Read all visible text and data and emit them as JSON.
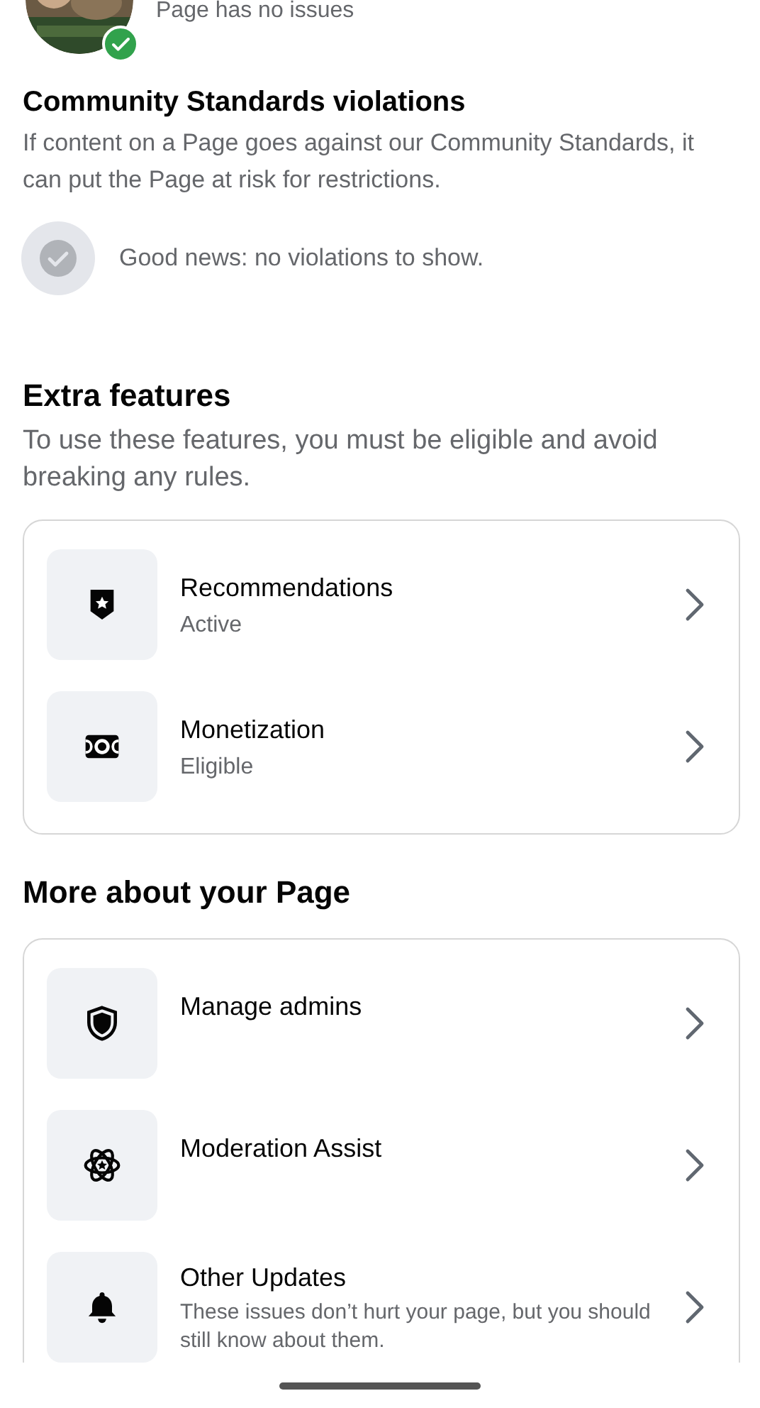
{
  "page_status": {
    "text": "Page has no issues",
    "verified": true
  },
  "violations": {
    "title": "Community Standards violations",
    "description": "If content on a Page goes against our Community Standards, it can put the Page at risk for restrictions.",
    "empty_message": "Good news: no violations to show."
  },
  "extra_features": {
    "title": "Extra features",
    "description": "To use these features, you must be eligible and avoid breaking any rules.",
    "items": [
      {
        "title": "Recommendations",
        "status": "Active"
      },
      {
        "title": "Monetization",
        "status": "Eligible"
      }
    ]
  },
  "more_about": {
    "title": "More about your Page",
    "items": [
      {
        "title": "Manage admins"
      },
      {
        "title": "Moderation Assist"
      },
      {
        "title": "Other Updates",
        "description": "These issues don’t hurt your page, but you should still know about them."
      }
    ]
  }
}
